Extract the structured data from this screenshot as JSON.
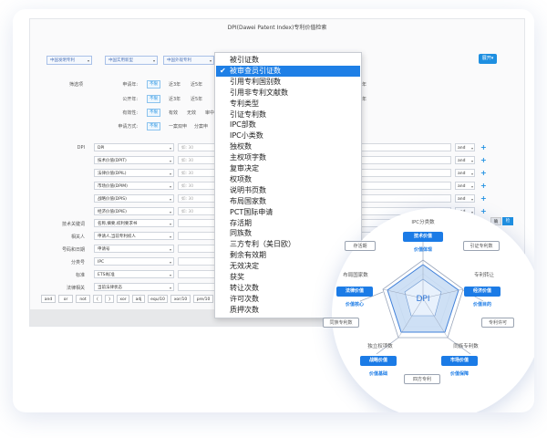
{
  "window": {
    "title": "DPI(Dawei Patent Index)专利价值检索",
    "scopes": [
      "中国发明专利",
      "中国实用新型",
      "中国外观专利"
    ],
    "expand_label": "展开▾"
  },
  "filters": {
    "title": "筛选项",
    "rows": [
      {
        "label": "申请年:",
        "chip": "不限",
        "options": [
          "近3年",
          "近5年"
        ]
      },
      {
        "label": "公开年:",
        "chip": "不限",
        "options": [
          "近3年",
          "近5年"
        ]
      },
      {
        "label": "有效性:",
        "chip": "不限",
        "options": [
          "有效",
          "无效",
          "审中"
        ]
      },
      {
        "label": "申请方式:",
        "chip": "不限",
        "options": [
          "一案双申",
          "分案申"
        ]
      }
    ],
    "year_right": "年"
  },
  "dpi_label": "DPI",
  "field_rows": [
    {
      "label": "DPI",
      "select": "DPI",
      "placeholder": "如: 30",
      "logic": "and"
    },
    {
      "label": "",
      "select": "技术价值(DPIT)",
      "placeholder": "如: 30",
      "logic": "and"
    },
    {
      "label": "",
      "select": "法律价值(DPIL)",
      "placeholder": "如: 30",
      "logic": "and"
    },
    {
      "label": "",
      "select": "市场价值(DPIM)",
      "placeholder": "如: 30",
      "logic": "and"
    },
    {
      "label": "",
      "select": "战略价值(DPIS)",
      "placeholder": "如: 30",
      "logic": "and"
    },
    {
      "label": "",
      "select": "经济价值(DPIE)",
      "placeholder": "如: 30",
      "logic": "and"
    },
    {
      "label": "技术关键词",
      "select": "名称,摘要,权利要求书",
      "placeholder": "",
      "logic": ""
    },
    {
      "label": "相关人",
      "select": "申请人,当前专利权人",
      "placeholder": "",
      "logic": ""
    },
    {
      "label": "号码和日期",
      "select": "申请号",
      "placeholder": "",
      "logic": ""
    },
    {
      "label": "分类号",
      "select": "IPC",
      "placeholder": "",
      "logic": ""
    },
    {
      "label": "标准",
      "select": "ETSI标准",
      "placeholder": "",
      "logic": ""
    },
    {
      "label": "法律相关",
      "select": "当前法律状态",
      "placeholder": "",
      "logic": ""
    }
  ],
  "side_buttons": {
    "gray": "确",
    "blue": "检"
  },
  "operators": [
    "and",
    "or",
    "not",
    "(",
    ")",
    "xor",
    "adj",
    "equ/10",
    "xor/10",
    "pre/10",
    "%"
  ],
  "dropdown": {
    "selected_index": 1,
    "items": [
      "被引证数",
      "被审查员引证数",
      "引用专利国别数",
      "引用非专利文献数",
      "专利类型",
      "引证专利数",
      "IPC部数",
      "IPC小类数",
      "独权数",
      "主权项字数",
      "复审决定",
      "权项数",
      "说明书页数",
      "布局国家数",
      "PCT国际申请",
      "存活期",
      "同族数",
      "三方专利（美日欧）",
      "剩余有效期",
      "无效决定",
      "获奖",
      "转让次数",
      "许可次数",
      "质押次数"
    ]
  },
  "radar": {
    "center_label": "DPI",
    "categories": {
      "top": "IPC分类数",
      "left": "布局国家数",
      "right": "专利转让",
      "bottom_left": "独立权项数",
      "bottom_right": "同族专利数"
    },
    "values": [
      {
        "name": "技术价值",
        "sub": "价值体现"
      },
      {
        "name": "法律价值",
        "sub": "价值核心"
      },
      {
        "name": "经济价值",
        "sub": "价值目的"
      },
      {
        "name": "战略价值",
        "sub": "价值基础"
      },
      {
        "name": "市场价值",
        "sub": "价值保障"
      }
    ],
    "outline_tags": {
      "survival": "存活期",
      "citation": "引证专利数",
      "family": "同族专利数",
      "license": "专利许可",
      "tri": "四方专利"
    }
  }
}
